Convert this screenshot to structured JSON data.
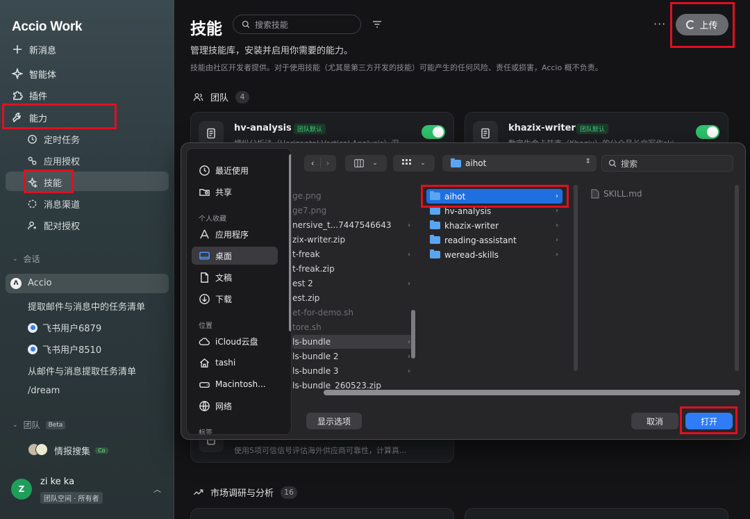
{
  "app": {
    "name": "Accio Work"
  },
  "sidebar": {
    "new_message": "新消息",
    "agents": "智能体",
    "plugins": "插件",
    "ability": "能力",
    "sub_items": [
      "定时任务",
      "应用授权",
      "技能",
      "消息渠道",
      "配对授权"
    ],
    "conversations_header": "会话",
    "conversations": [
      "Accio",
      "提取邮件与消息中的任务清单",
      "飞书用户6879",
      "飞书用户8510",
      "从邮件与消息提取任务清单",
      "/dream"
    ],
    "team_header": "团队",
    "team_badge": "Beta",
    "team_item": "情报搜集",
    "team_item_tag": "Co",
    "user": {
      "initial": "Z",
      "name": "zi ke ka",
      "space": "团队空间 · 所有者"
    }
  },
  "main": {
    "title": "技能",
    "search_placeholder": "搜索技能",
    "more": "···",
    "upload": "上传",
    "description": "管理技能库，安装并启用你需要的能力。",
    "disclaimer": "技能由社区开发者提供。对于使用技能（尤其是第三方开发的技能）可能产生的任何风险、责任或损害，Accio 概不负责。",
    "group_team": {
      "label": "团队",
      "count": "4"
    },
    "cards": [
      {
        "name": "hv-analysis",
        "badge": "团队默认",
        "desc": "横纵分析法（Horizontal-Vertical Analysis）深",
        "enabled": true
      },
      {
        "name": "khazix-writer",
        "badge": "团队默认",
        "desc": "数字生命卡兹克（Khazix）的公众号长文写作ski",
        "enabled": true
      }
    ],
    "card_partial_desc": "使用5项可信信号评估海外供应商可靠性，计算真...",
    "group_market": {
      "label": "市场调研与分析",
      "count": "16"
    }
  },
  "dialog": {
    "sidebar_items": {
      "recent": "最近使用",
      "shared": "共享",
      "favorites_header": "个人收藏",
      "applications": "应用程序",
      "desktop": "桌面",
      "documents": "文稿",
      "downloads": "下载",
      "locations_header": "位置",
      "icloud": "iCloud云盘",
      "tashi": "tashi",
      "macintosh": "Macintosh...",
      "network": "网络",
      "tags_header": "标签"
    },
    "path_folder": "aihot",
    "search_placeholder": "搜索",
    "column1": [
      {
        "name": "ge.png",
        "dim": true
      },
      {
        "name": "ge7.png",
        "dim": true
      },
      {
        "name": "nersive_t...7447546643",
        "folder": true
      },
      {
        "name": "zix-writer.zip"
      },
      {
        "name": "t-freak",
        "folder": true
      },
      {
        "name": "t-freak.zip"
      },
      {
        "name": "est 2",
        "folder": true
      },
      {
        "name": "est.zip"
      },
      {
        "name": "et-for-demo.sh",
        "dim": true
      },
      {
        "name": "tore.sh",
        "dim": true
      },
      {
        "name": "ls-bundle",
        "folder": true,
        "highlight": true
      },
      {
        "name": "ls-bundle 2",
        "folder": true
      },
      {
        "name": "ls-bundle 3",
        "folder": true
      },
      {
        "name": "ls-bundle_260523.zip"
      }
    ],
    "column2": [
      "aihot",
      "hv-analysis",
      "khazix-writer",
      "reading-assistant",
      "weread-skills"
    ],
    "column3_file": "SKILL.md",
    "show_options": "显示选项",
    "cancel": "取消",
    "open": "打开"
  }
}
